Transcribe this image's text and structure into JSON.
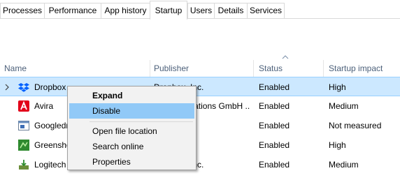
{
  "tabs": [
    {
      "label": "Processes",
      "active": false
    },
    {
      "label": "Performance",
      "active": false
    },
    {
      "label": "App history",
      "active": false
    },
    {
      "label": "Startup",
      "active": true
    },
    {
      "label": "Users",
      "active": false
    },
    {
      "label": "Details",
      "active": false
    },
    {
      "label": "Services",
      "active": false
    }
  ],
  "columns": {
    "name": "Name",
    "publisher": "Publisher",
    "status": "Status",
    "impact": "Startup impact",
    "sorted_by": "status"
  },
  "rows": [
    {
      "name": "Dropbox",
      "publisher": "Dropbox, Inc.",
      "status": "Enabled",
      "impact": "High",
      "icon": "dropbox-icon",
      "selected": true,
      "expandable": true
    },
    {
      "name": "Avira",
      "publisher": "Avira Operations GmbH ...",
      "status": "Enabled",
      "impact": "Medium",
      "icon": "avira-icon",
      "selected": false
    },
    {
      "name": "Googledrivesync",
      "publisher": "",
      "status": "Enabled",
      "impact": "Not measured",
      "icon": "googledrive-icon",
      "selected": false
    },
    {
      "name": "Greenshot",
      "publisher": "",
      "status": "Enabled",
      "impact": "High",
      "icon": "greenshot-icon",
      "selected": false
    },
    {
      "name": "Logitech",
      "publisher": "Logitech, Inc.",
      "status": "Enabled",
      "impact": "Medium",
      "icon": "logitech-icon",
      "selected": false
    }
  ],
  "context_menu": {
    "items": [
      {
        "label": "Expand",
        "bold": true,
        "highlighted": false
      },
      {
        "label": "Disable",
        "bold": false,
        "highlighted": true
      },
      {
        "label": "Open file location",
        "bold": false,
        "highlighted": false
      },
      {
        "label": "Search online",
        "bold": false,
        "highlighted": false
      },
      {
        "label": "Properties",
        "bold": false,
        "highlighted": false
      }
    ]
  },
  "colors": {
    "selected_row": "#cce8ff",
    "menu_highlight": "#91c9f7",
    "header_text": "#4c607a"
  }
}
